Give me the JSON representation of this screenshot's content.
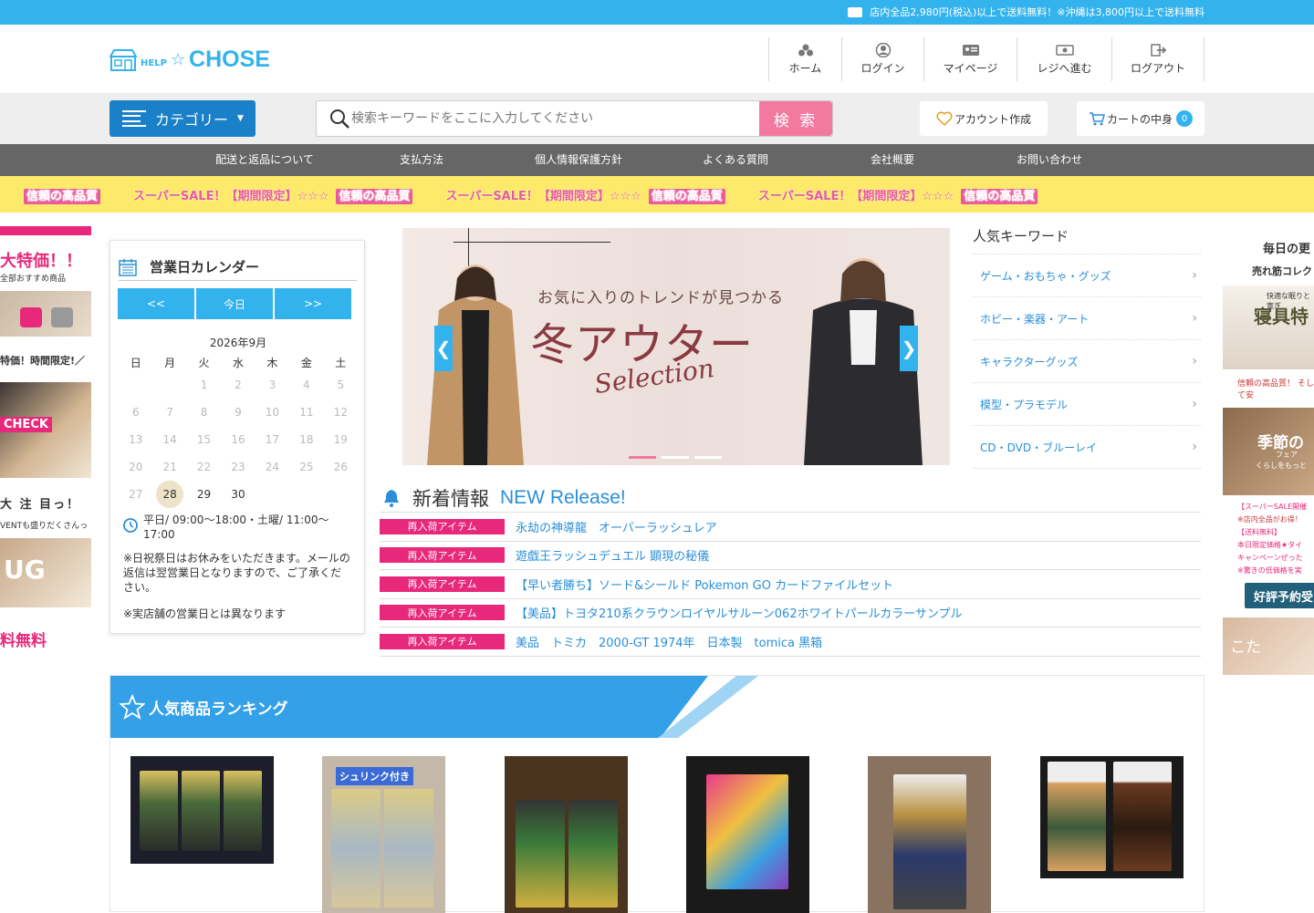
{
  "topbar": {
    "message": "店内全品2,980円(税込)以上で送料無料！※沖縄は3,800円以上で送料無料"
  },
  "logo": {
    "help": "HELP",
    "brand": "CHOSE"
  },
  "header_nav": [
    {
      "label": "ホーム",
      "icon": "home-icon"
    },
    {
      "label": "ログイン",
      "icon": "user-icon"
    },
    {
      "label": "マイページ",
      "icon": "id-card-icon"
    },
    {
      "label": "レジへ進む",
      "icon": "register-icon"
    },
    {
      "label": "ログアウト",
      "icon": "logout-icon"
    }
  ],
  "search": {
    "category_label": "カテゴリー",
    "placeholder": "検索キーワードをここに入力してください",
    "button": "検 索"
  },
  "account": {
    "label": "アカウント作成"
  },
  "cart": {
    "label": "カートの中身",
    "count": "0"
  },
  "global_nav": [
    "配送と返品について",
    "支払方法",
    "個人情報保護方針",
    "よくある質問",
    "会社概要",
    "お問い合わせ"
  ],
  "banner": {
    "text": "スーパーSALE！【期間限定】☆☆☆",
    "highlight": "信頼の高品質"
  },
  "left_ad": {
    "t1": "大特価！！",
    "s1": "全部おすすめ商品",
    "t2": "特価！時間限定!／",
    "check": "CHECK",
    "t3": "大 注 目っ！",
    "s2": "VENTも盛りだくさんっ",
    "img3": "UG",
    "t4": "料無料"
  },
  "calendar": {
    "title": "営業日カレンダー",
    "prev": "<<",
    "today": "今日",
    "next": ">>",
    "month": "2026年9月",
    "weekdays": [
      "日",
      "月",
      "火",
      "水",
      "木",
      "金",
      "土"
    ],
    "hours": "平日/ 09:00～18:00・土曜/ 11:00～17:00",
    "note1": "※日祝祭日はお休みをいただきます。メールの返信は翌営業日となりますので、ご了承ください。",
    "note2": "※実店舗の営業日とは異なります"
  },
  "slider": {
    "line1": "お気に入りのトレンドが見つかる",
    "line2": "冬アウター",
    "line3": "Selection",
    "prev": "❮",
    "next": "❯"
  },
  "keywords": {
    "title": "人気キーワード",
    "items": [
      "ゲーム・おもちゃ・グッズ",
      "ホビー・楽器・アート",
      "キャラクターグッズ",
      "模型・プラモデル",
      "CD・DVD・ブルーレイ"
    ]
  },
  "right_ad": {
    "t1": "毎日の更",
    "t2": "売れ筋コレク",
    "i1s": "快適な眠りと寛ぎ",
    "i1b": "寝具特",
    "t3": "信頼の高品質！ そして安",
    "i2b": "季節の",
    "i2s": "フェア",
    "i2s2": "くらしをもっと",
    "lines": [
      "【スーパーSALE開催",
      "※店内全品がお得！",
      "【送料無料】",
      "本日限定価格★タイ",
      "キャンペーンぜった",
      "※驚きの低価格を実"
    ],
    "btn": "好評予約受",
    "i3": "こた"
  },
  "news": {
    "title_jp": "新着情報",
    "title_en": "NEW Release!",
    "items": [
      {
        "tag": "再入荷アイテム",
        "text": "永劫の神導龍　オーバーラッシュレア"
      },
      {
        "tag": "再入荷アイテム",
        "text": "遊戯王ラッシュデュエル 顕現の秘儀"
      },
      {
        "tag": "再入荷アイテム",
        "text": "【早い者勝ち】ソード&シールド Pokemon GO カードファイルセット"
      },
      {
        "tag": "再入荷アイテム",
        "text": "【美品】トヨタ210系クラウンロイヤルサルーン062ホワイトパールカラーサンプル"
      },
      {
        "tag": "再入荷アイテム",
        "text": "美品　トミカ　2000-GT 1974年　日本製　tomica 黒箱"
      }
    ]
  },
  "ranking": {
    "title": "人気商品ランキング",
    "shrink_label": "シュリンク付き"
  },
  "colors": {
    "brand": "#33b3ee",
    "pink": "#e8287a",
    "dark_blue": "#1a80c8"
  }
}
